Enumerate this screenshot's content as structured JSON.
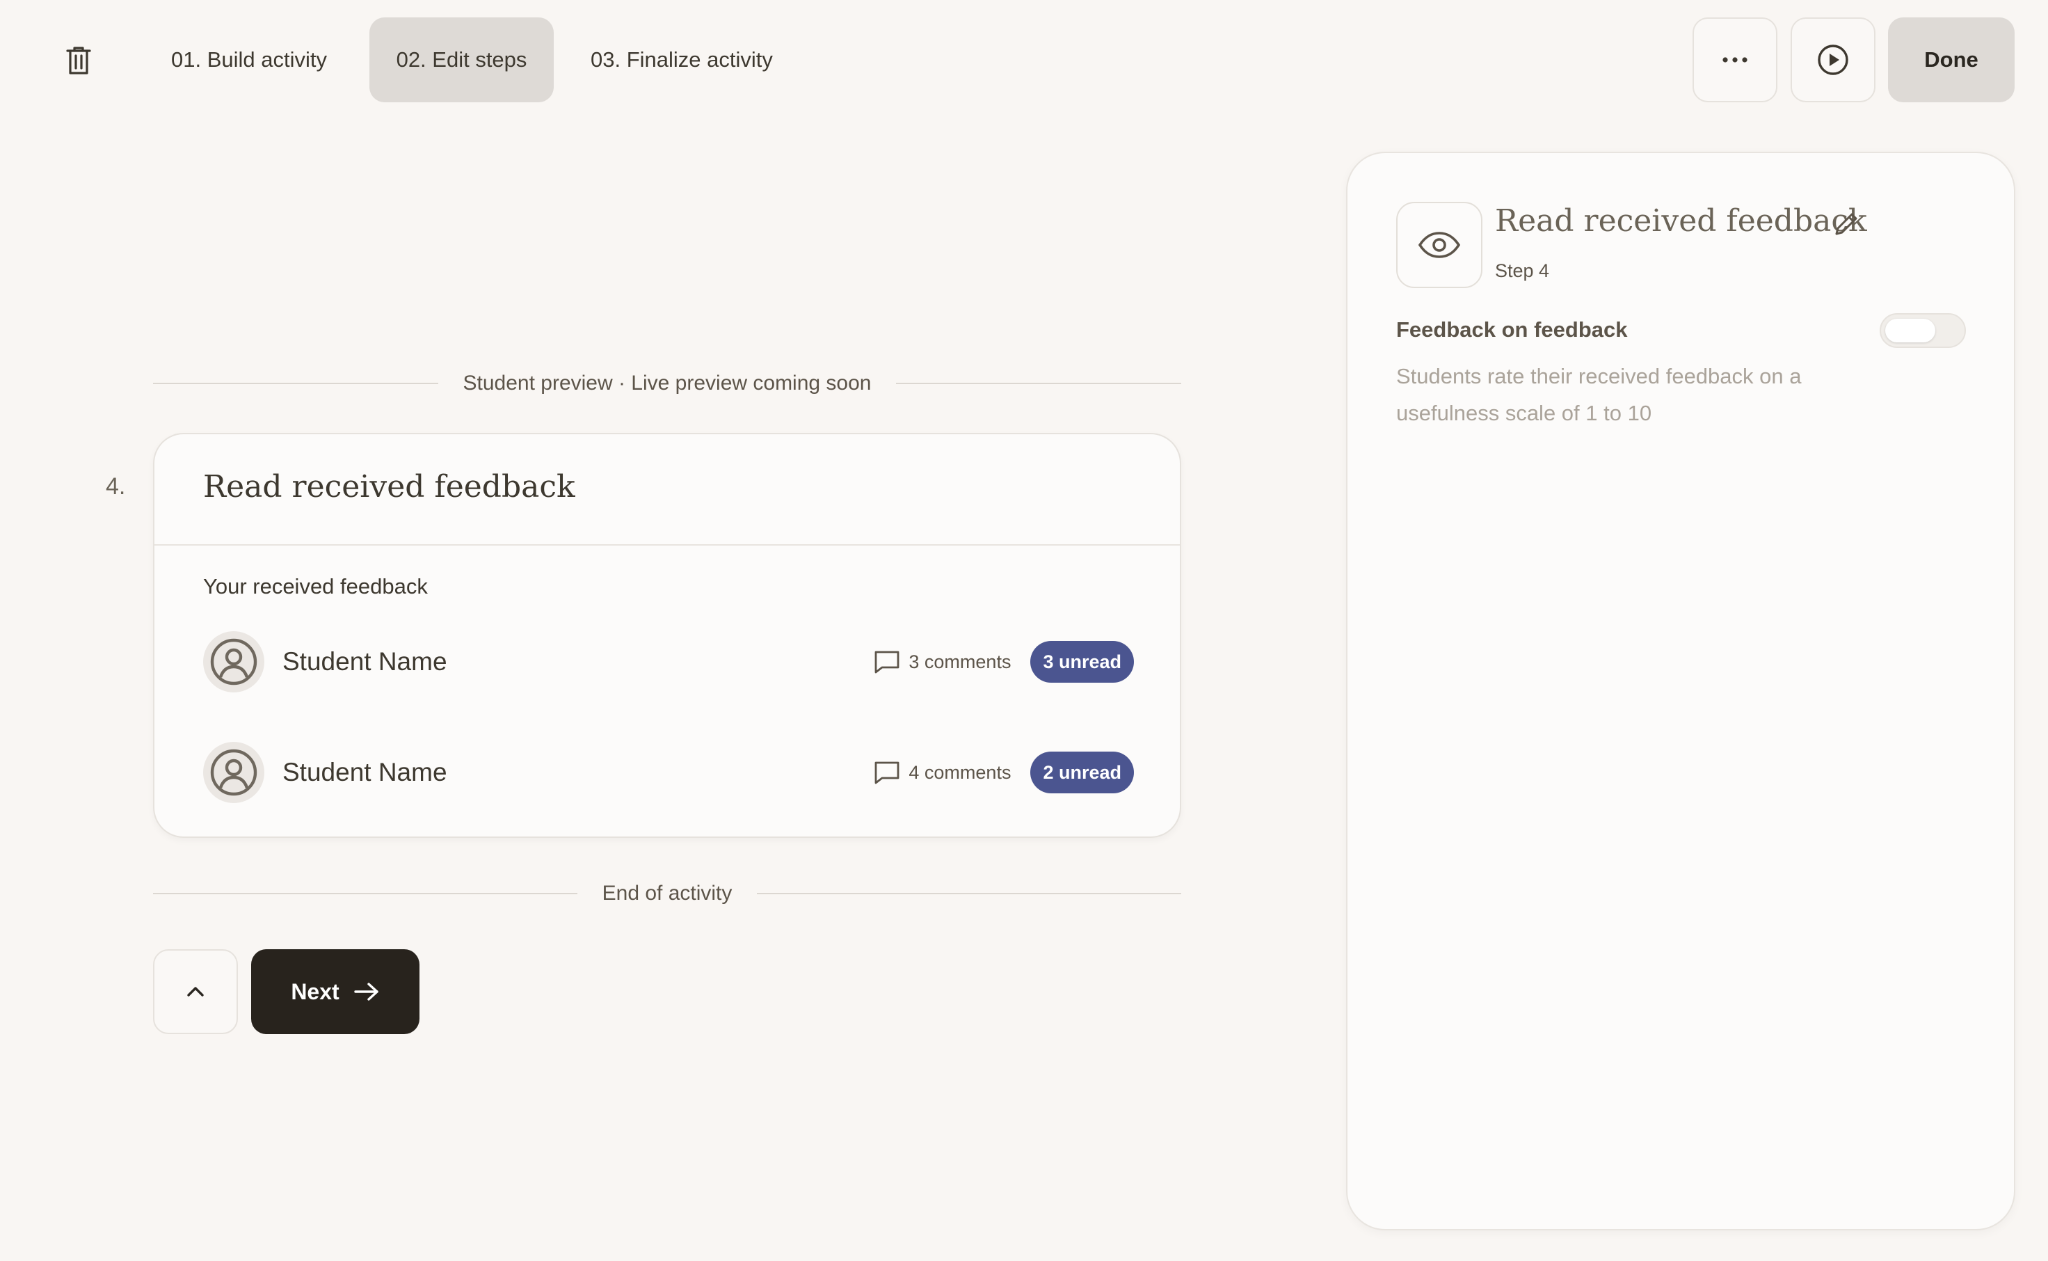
{
  "topbar": {
    "tabs": [
      {
        "label": "01. Build activity",
        "active": false
      },
      {
        "label": "02. Edit steps",
        "active": true
      },
      {
        "label": "03. Finalize activity",
        "active": false
      }
    ],
    "icons": {
      "delete": "trash-icon",
      "more": "more-horizontal-icon",
      "preview": "play-circle-icon"
    },
    "done_label": "Done"
  },
  "preview": {
    "header": "Student preview · Live preview coming soon",
    "footer": "End of activity",
    "step_number": "4.",
    "card": {
      "title": "Read received feedback",
      "subtitle": "Your received feedback",
      "rows": [
        {
          "name": "Student Name",
          "comments": "3 comments",
          "unread": "3 unread"
        },
        {
          "name": "Student Name",
          "comments": "4 comments",
          "unread": "2 unread"
        }
      ]
    }
  },
  "nav": {
    "next_label": "Next",
    "up_icon": "chevron-up-icon",
    "next_icon": "arrow-right-icon"
  },
  "panel": {
    "title": "Read received feedback",
    "step": "Step 4",
    "icon": "eye-icon",
    "feedback_on_feedback": {
      "title": "Feedback on feedback",
      "description": "Students rate their received feedback on a usefulness scale of 1 to 10",
      "enabled": false
    }
  },
  "colors": {
    "background": "#f9f6f3",
    "accent_badge": "#4b5590",
    "primary_button": "#28231d",
    "active_tab": "#dedad6"
  }
}
